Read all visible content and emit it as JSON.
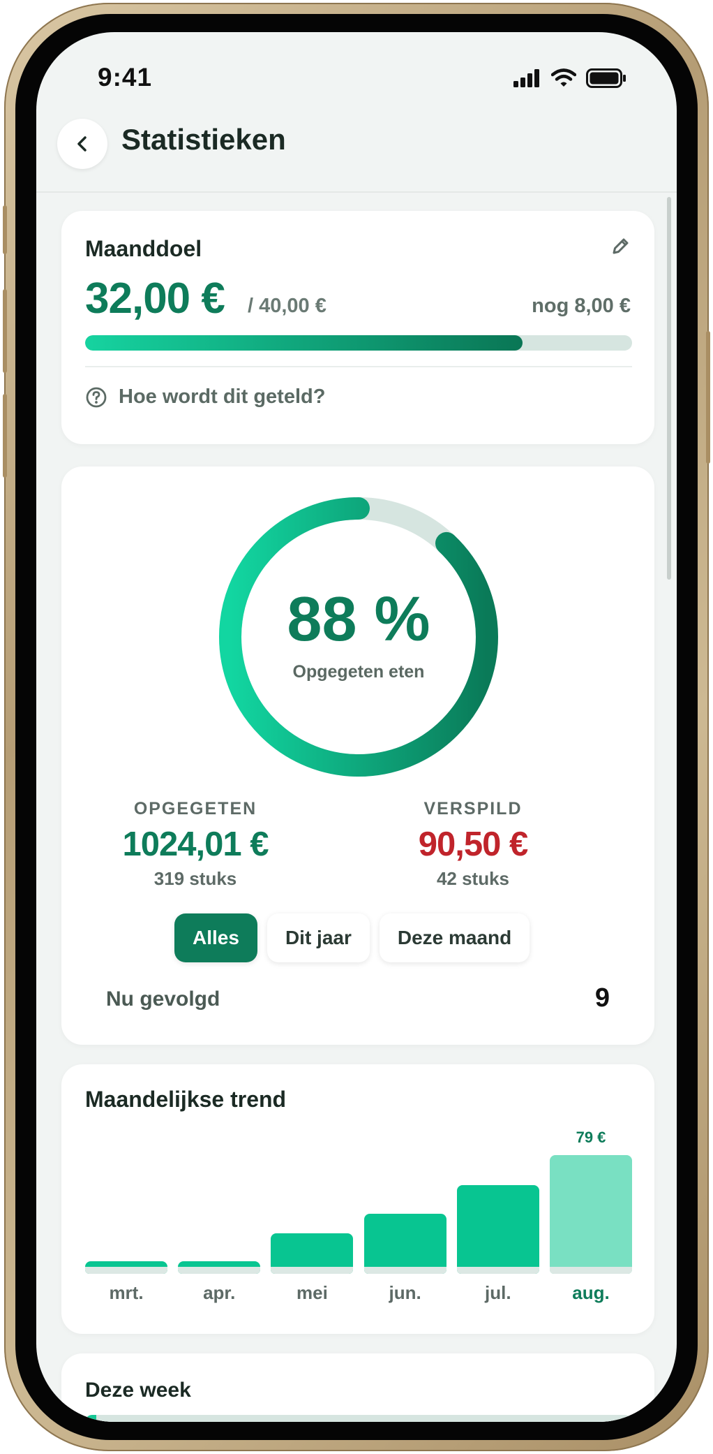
{
  "status_bar": {
    "time": "9:41"
  },
  "header": {
    "title": "Statistieken"
  },
  "goal": {
    "title": "Maanddoel",
    "amount": "32,00 €",
    "target": "/ 40,00 €",
    "remaining": "nog 8,00 €",
    "progress_fraction": 0.8,
    "help_text": "Hoe wordt dit geteld?"
  },
  "summary": {
    "ring_value": "88 %",
    "ring_label": "Opgegeten eten",
    "ring_fraction": 0.88,
    "eaten": {
      "label": "OPGEGETEN",
      "amount": "1024,01 €",
      "count": "319 stuks"
    },
    "wasted": {
      "label": "VERSPILD",
      "amount": "90,50 €",
      "count": "42 stuks"
    },
    "filters": [
      "Alles",
      "Dit jaar",
      "Deze maand"
    ],
    "active_filter": "Alles",
    "tracked_label": "Nu gevolgd",
    "tracked_value": "9"
  },
  "trend": {
    "title": "Maandelijkse trend",
    "chart_data": {
      "type": "bar",
      "categories": [
        "mrt.",
        "apr.",
        "mei",
        "jun.",
        "jul.",
        "aug."
      ],
      "values": [
        4,
        6,
        27,
        40,
        59,
        79
      ],
      "highlight_index": 5,
      "value_label": "79 €"
    }
  },
  "week": {
    "title": "Deze week",
    "progress_fraction": 0.02
  },
  "colors": {
    "accent": "#0e7c5a",
    "bar": "#08c591",
    "bar_current": "#79e0c2",
    "wasted": "#c0242b"
  }
}
